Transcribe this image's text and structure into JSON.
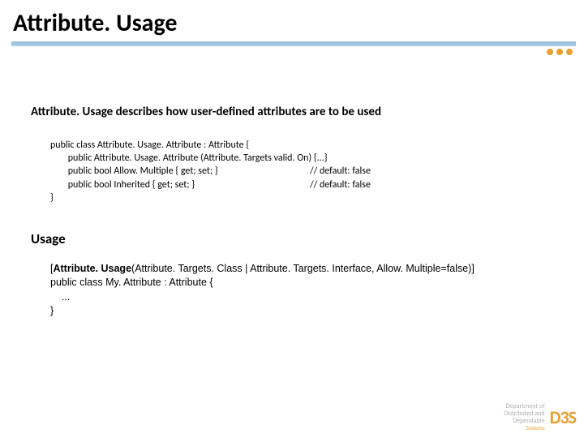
{
  "title": "Attribute. Usage",
  "intro": "Attribute. Usage describes how user-defined attributes are to be used",
  "code1": {
    "l1": "public class Attribute. Usage. Attribute : Attribute {",
    "l2": "        public Attribute. Usage. Attribute (Attribute. Targets valid. On) {...}",
    "l3a": "        public bool Allow. Multiple { get; set; }",
    "l3b": "// default: false",
    "l4a": "        public bool Inherited { get; set; }",
    "l4b": "// default: false",
    "l5": "}"
  },
  "usageHeading": "Usage",
  "code2": {
    "l1a": "[",
    "l1b": "Attribute. Usage",
    "l1c": "(Attribute. Targets. Class | Attribute. Targets. Interface, Allow. Multiple=false)]",
    "l2": "public class My. Attribute : Attribute {",
    "l3": "    ...",
    "l4": "}"
  },
  "footer": {
    "line1": "Department of",
    "line2": "Distributed and",
    "line3": "Dependable",
    "line4": "Systems",
    "logo": "D3S"
  }
}
